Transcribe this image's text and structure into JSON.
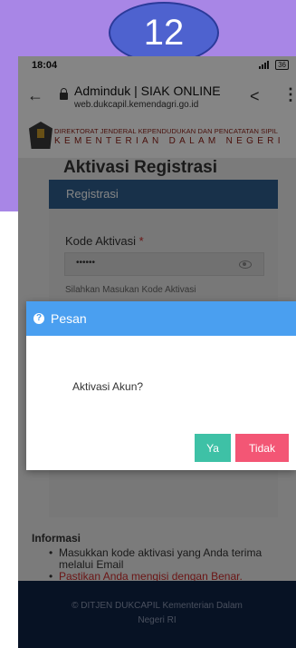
{
  "step_number": "12",
  "status_bar": {
    "time": "18:04",
    "battery": "36"
  },
  "browser": {
    "title": "Adminduk | SIAK ONLINE",
    "url": "web.dukcapil.kemendagri.go.id"
  },
  "site_header": {
    "line1": "DIREKTORAT JENDERAL KEPENDUDUKAN DAN PENCATATAN SIPIL",
    "line2": "KEMENTERIAN DALAM NEGERI"
  },
  "page": {
    "title": "Aktivasi Registrasi",
    "card_title": "Registrasi",
    "field_label": "Kode Aktivasi",
    "required_mark": "*",
    "field_value": "••••••",
    "hint": "Silahkan Masukan Kode Aktivasi"
  },
  "info": {
    "title": "Informasi",
    "items": [
      "Masukkan kode aktivasi yang Anda terima melalui Email",
      "Pastikan Anda mengisi dengan Benar."
    ]
  },
  "footer": {
    "text": "© DITJEN DUKCAPIL Kementerian Dalam Negeri RI"
  },
  "dialog": {
    "title": "Pesan",
    "message": "Aktivasi Akun?",
    "yes_label": "Ya",
    "no_label": "Tidak"
  },
  "colors": {
    "purple_bg": "#a886e6",
    "badge": "#4e62cf",
    "dialog_header": "#4a9ff0",
    "yes_button": "#3ec1a6",
    "no_button": "#f35675",
    "card_header": "#2e5f8e",
    "footer": "#0f2345"
  }
}
